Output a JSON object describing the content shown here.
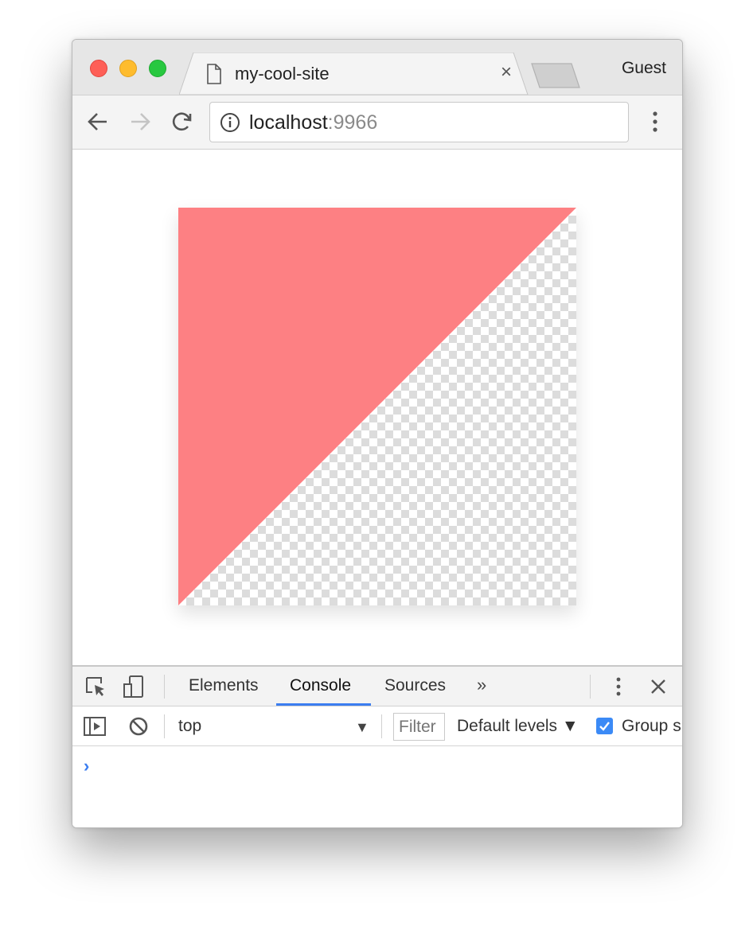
{
  "browser": {
    "tab_title": "my-cool-site",
    "tab_close": "×",
    "profile_name": "Guest"
  },
  "toolbar": {
    "url_host": "localhost",
    "url_port": ":9966"
  },
  "devtools": {
    "tabs": [
      {
        "label": "Elements"
      },
      {
        "label": "Console"
      },
      {
        "label": "Sources"
      }
    ],
    "more_tabs": "»",
    "close": "×",
    "console": {
      "context": "top",
      "filter_placeholder": "Filter",
      "levels": "Default levels ▼",
      "group_label": "Group s",
      "prompt": "›"
    }
  },
  "colors": {
    "triangle_fill": "#fd8083",
    "checker_light": "#ffffff",
    "checker_dark": "#dcdcdc",
    "accent": "#3b7df0"
  }
}
